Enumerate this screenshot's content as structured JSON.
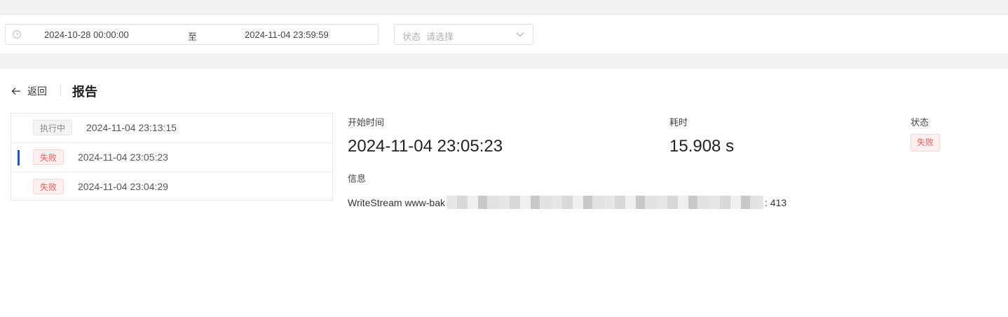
{
  "filters": {
    "date_range": {
      "start": "2024-10-28 00:00:00",
      "separator": "至",
      "end": "2024-11-04 23:59:59"
    },
    "status": {
      "label": "状态",
      "placeholder": "请选择"
    }
  },
  "header": {
    "back_label": "返回",
    "title": "报告"
  },
  "runs": [
    {
      "status": "执行中",
      "time": "2024-11-04 23:13:15",
      "active": false
    },
    {
      "status": "失败",
      "time": "2024-11-04 23:05:23",
      "active": true
    },
    {
      "status": "失败",
      "time": "2024-11-04 23:04:29",
      "active": false
    }
  ],
  "detail": {
    "start_time_label": "开始时间",
    "start_time": "2024-11-04 23:05:23",
    "duration_label": "耗时",
    "duration": "15.908 s",
    "status_label": "状态",
    "status": "失败",
    "info_label": "信息",
    "info_prefix": "WriteStream www-bak",
    "info_suffix": ": 413"
  },
  "colors": {
    "accent": "#1e50e6",
    "fail_text": "#f05a5a",
    "fail_bg": "#fef0f0"
  }
}
